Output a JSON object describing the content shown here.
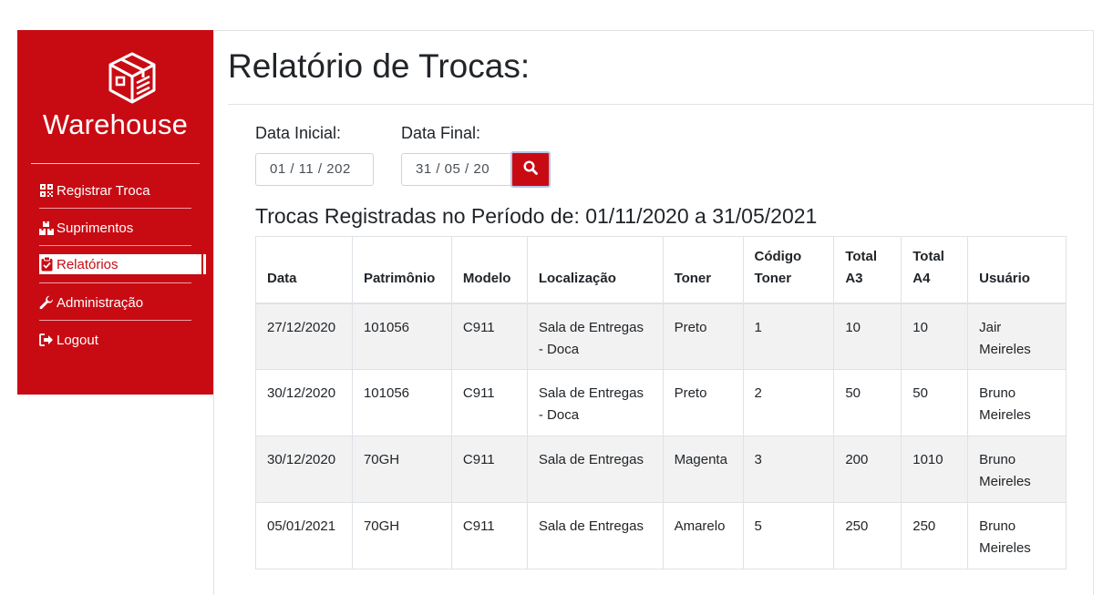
{
  "sidebar": {
    "brand": "Warehouse",
    "items": [
      {
        "label": "Registrar Troca",
        "icon": "qrcode-icon"
      },
      {
        "label": "Suprimentos",
        "icon": "boxes-icon"
      },
      {
        "label": "Relatórios",
        "icon": "clipboard-check-icon",
        "active": true
      },
      {
        "label": "Administração",
        "icon": "wrench-icon"
      },
      {
        "label": "Logout",
        "icon": "sign-out-icon"
      }
    ]
  },
  "page": {
    "title": "Relatório de Trocas:"
  },
  "filters": {
    "start_label": "Data Inicial:",
    "start_value": "01 / 11 / 202",
    "end_label": "Data Final:",
    "end_value": "31 / 05 / 20",
    "search_icon": "search-icon"
  },
  "period_text": "Trocas Registradas no Período de: 01/11/2020 a 31/05/2021",
  "table": {
    "headers": [
      "Data",
      "Patrimônio",
      "Modelo",
      "Localização",
      "Toner",
      "Código Toner",
      "Total A3",
      "Total A4",
      "Usuário"
    ],
    "rows": [
      [
        "27/12/2020",
        "101056",
        "C911",
        "Sala de Entregas - Doca",
        "Preto",
        "1",
        "10",
        "10",
        "Jair Meireles"
      ],
      [
        "30/12/2020",
        "101056",
        "C911",
        "Sala de Entregas - Doca",
        "Preto",
        "2",
        "50",
        "50",
        "Bruno Meireles"
      ],
      [
        "30/12/2020",
        "70GH",
        "C911",
        "Sala de Entregas",
        "Magenta",
        "3",
        "200",
        "1010",
        "Bruno Meireles"
      ],
      [
        "05/01/2021",
        "70GH",
        "C911",
        "Sala de Entregas",
        "Amarelo",
        "5",
        "250",
        "250",
        "Bruno Meireles"
      ]
    ]
  },
  "colors": {
    "brand_red": "#c80b13",
    "row_stripe": "#f2f2f2"
  }
}
